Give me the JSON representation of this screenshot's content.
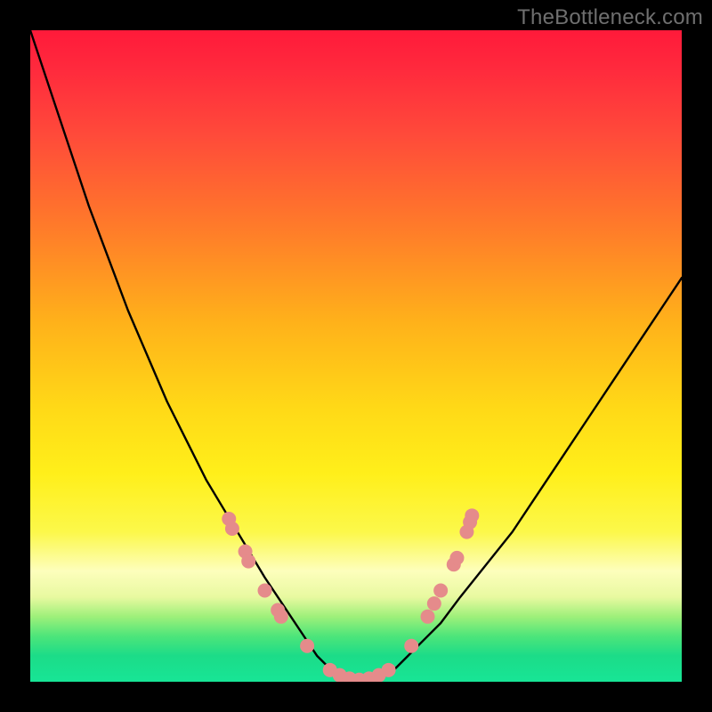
{
  "watermark": "TheBottleneck.com",
  "chart_data": {
    "type": "line",
    "title": "",
    "xlabel": "",
    "ylabel": "",
    "xlim": [
      0,
      100
    ],
    "ylim": [
      0,
      100
    ],
    "grid": false,
    "legend": false,
    "background_gradient": {
      "orientation": "vertical",
      "stops": [
        {
          "pos": 0.0,
          "color": "#ff1a3a"
        },
        {
          "pos": 0.3,
          "color": "#ff7a2a"
        },
        {
          "pos": 0.58,
          "color": "#ffd917"
        },
        {
          "pos": 0.83,
          "color": "#fdfebc"
        },
        {
          "pos": 1.0,
          "color": "#17e596"
        }
      ]
    },
    "series": [
      {
        "name": "bottleneck-curve",
        "color": "#000000",
        "x": [
          0,
          3,
          6,
          9,
          12,
          15,
          18,
          21,
          24,
          27,
          30,
          33,
          36,
          38,
          40,
          42,
          44,
          46,
          48,
          50,
          52,
          54,
          56,
          58,
          60,
          63,
          66,
          70,
          74,
          78,
          82,
          86,
          90,
          94,
          98,
          100
        ],
        "y": [
          100,
          91,
          82,
          73,
          65,
          57,
          50,
          43,
          37,
          31,
          26,
          21,
          16,
          13,
          10,
          7,
          4,
          2,
          1,
          0,
          0,
          1,
          2,
          4,
          6,
          9,
          13,
          18,
          23,
          29,
          35,
          41,
          47,
          53,
          59,
          62
        ]
      }
    ],
    "markers": {
      "name": "highlight-dots",
      "color": "#e58b8b",
      "radius": 8,
      "points": [
        {
          "x": 30.5,
          "y": 25.0
        },
        {
          "x": 31.0,
          "y": 23.5
        },
        {
          "x": 33.0,
          "y": 20.0
        },
        {
          "x": 33.5,
          "y": 18.5
        },
        {
          "x": 36.0,
          "y": 14.0
        },
        {
          "x": 38.0,
          "y": 11.0
        },
        {
          "x": 38.5,
          "y": 10.0
        },
        {
          "x": 42.5,
          "y": 5.5
        },
        {
          "x": 46.0,
          "y": 1.8
        },
        {
          "x": 47.5,
          "y": 1.0
        },
        {
          "x": 49.0,
          "y": 0.5
        },
        {
          "x": 50.5,
          "y": 0.3
        },
        {
          "x": 52.0,
          "y": 0.5
        },
        {
          "x": 53.5,
          "y": 1.0
        },
        {
          "x": 55.0,
          "y": 1.8
        },
        {
          "x": 58.5,
          "y": 5.5
        },
        {
          "x": 61.0,
          "y": 10.0
        },
        {
          "x": 62.0,
          "y": 12.0
        },
        {
          "x": 63.0,
          "y": 14.0
        },
        {
          "x": 65.0,
          "y": 18.0
        },
        {
          "x": 65.5,
          "y": 19.0
        },
        {
          "x": 67.0,
          "y": 23.0
        },
        {
          "x": 67.5,
          "y": 24.5
        },
        {
          "x": 67.8,
          "y": 25.5
        }
      ]
    }
  }
}
